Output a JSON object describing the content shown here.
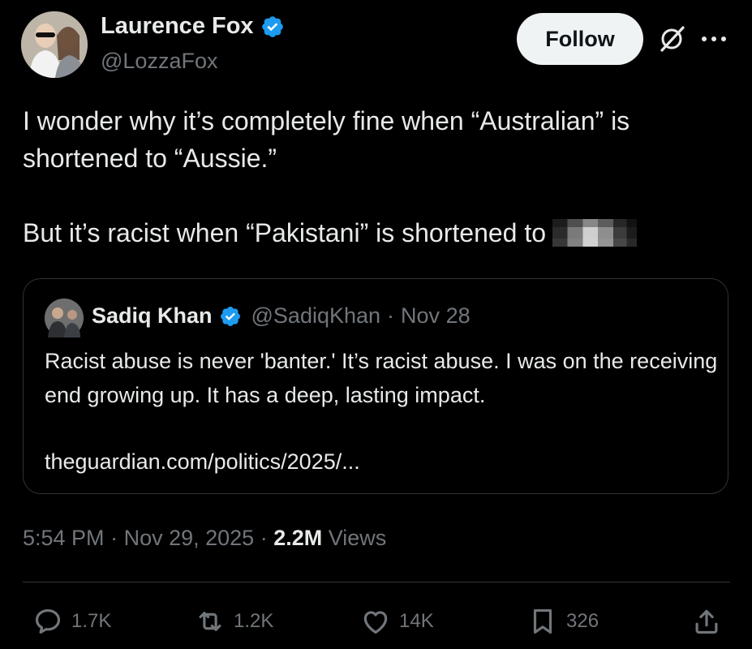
{
  "author": {
    "name": "Laurence Fox",
    "handle": "@LozzaFox",
    "verified": true
  },
  "follow_label": "Follow",
  "tweet": {
    "line1": "I wonder why it’s completely fine when “Australian” is shortened to “Aussie.”",
    "line2": "But it’s racist when “Pakistani” is shortened to"
  },
  "quote": {
    "name": "Sadiq Khan",
    "handle": "@SadiqKhan",
    "date": "Nov 28",
    "text": "Racist abuse is never 'banter.' It’s racist abuse. I was on the receiving end growing up. It has a deep, lasting impact.",
    "link": "theguardian.com/politics/2025/..."
  },
  "meta": {
    "time": "5:54 PM",
    "date": "Nov 29, 2025",
    "views_count": "2.2M",
    "views_label": "Views"
  },
  "actions": {
    "replies": "1.7K",
    "reposts": "1.2K",
    "likes": "14K",
    "bookmarks": "326"
  },
  "icons": [
    "verified-badge-icon",
    "grok-icon",
    "more-icon",
    "reply-icon",
    "repost-icon",
    "like-icon",
    "bookmark-icon",
    "share-icon"
  ],
  "colors": {
    "background": "#000000",
    "text": "#e7e9ea",
    "muted": "#71767b",
    "verified": "#1d9bf0",
    "border": "#2f3336"
  }
}
